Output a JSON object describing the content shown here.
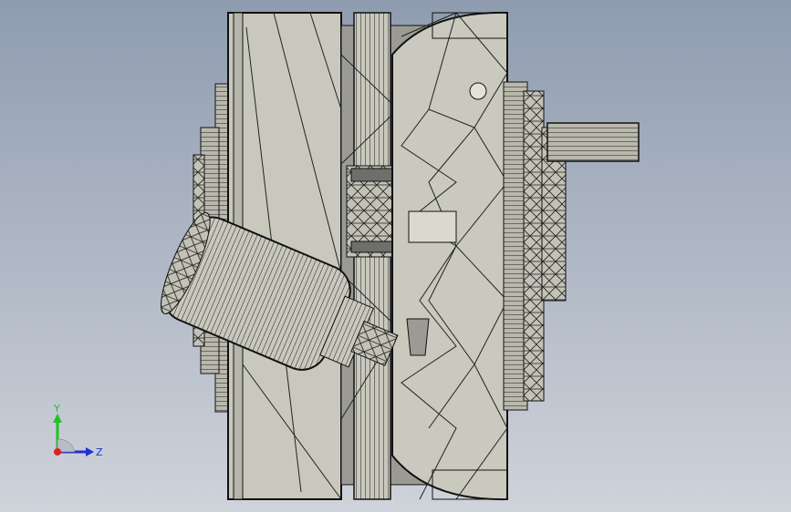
{
  "viewport": {
    "background_top": "#8f9cb0",
    "background_bottom": "#cfd3da",
    "model_fill": "#c9c8bd",
    "model_edge": "#1a1a1a",
    "model_shadow": "#6f6f6a"
  },
  "triad": {
    "y_label": "Y",
    "z_label": "Z",
    "y_color": "#22c022",
    "z_color": "#2230d0",
    "origin_color": "#e02020"
  }
}
